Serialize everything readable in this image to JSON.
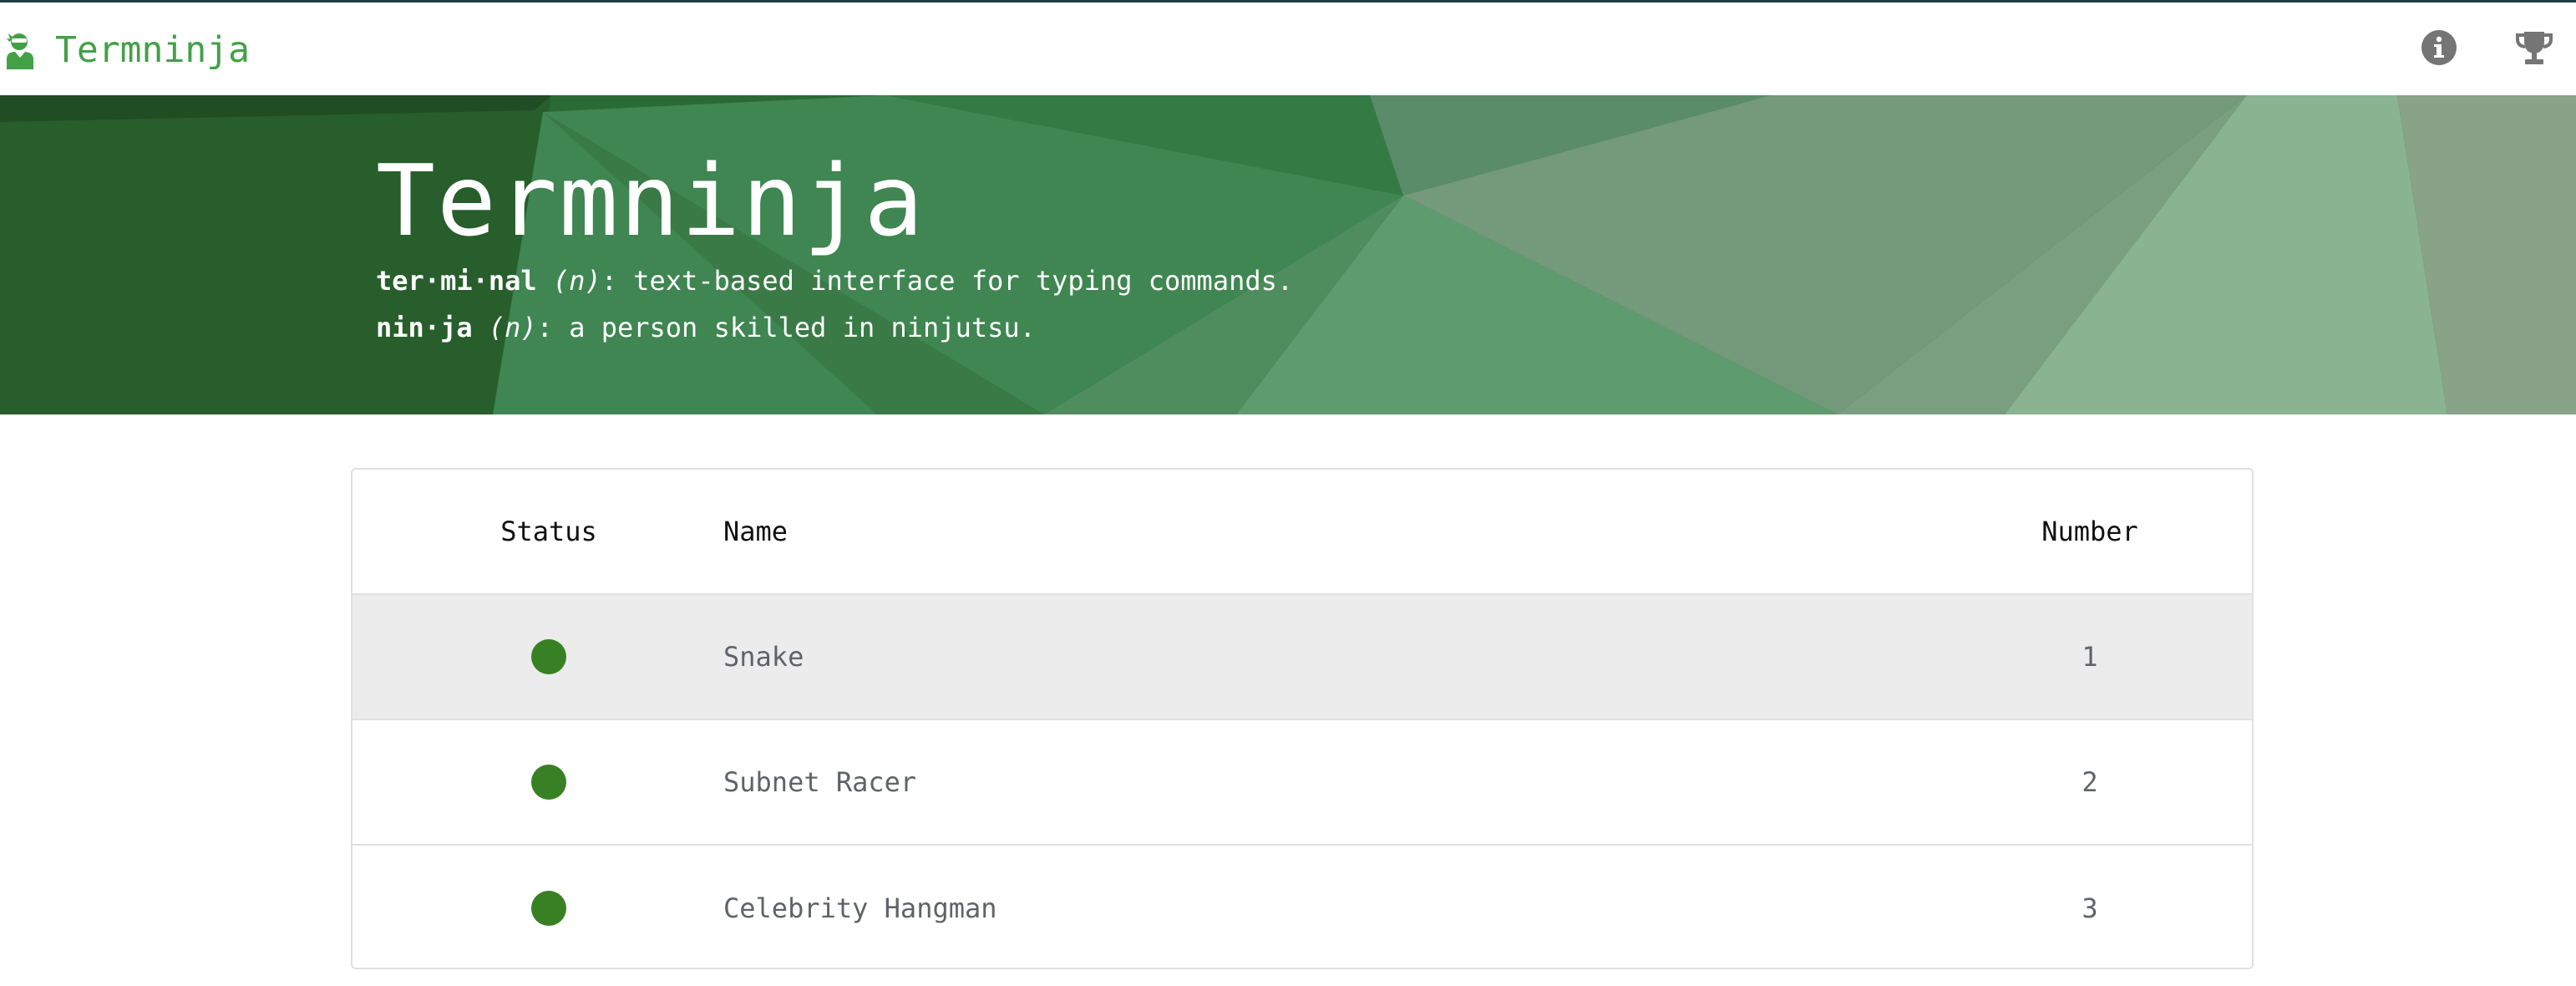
{
  "app": {
    "brand_text": "Termninja",
    "brand_color": "#43a047"
  },
  "navbar": {
    "icons": [
      "info-icon",
      "trophy-icon"
    ]
  },
  "hero": {
    "title": "Termninja",
    "definitions": [
      {
        "term": "ter·mi·nal",
        "pos": "(n)",
        "text": ": text-based interface for typing commands."
      },
      {
        "term": "nin·ja",
        "pos": "(n)",
        "text": ": a person skilled in ninjutsu."
      }
    ]
  },
  "table": {
    "headers": {
      "status": "Status",
      "name": "Name",
      "number": "Number"
    },
    "rows": [
      {
        "status": "online",
        "name": "Snake",
        "number": "1"
      },
      {
        "status": "online",
        "name": "Subnet Racer",
        "number": "2"
      },
      {
        "status": "online",
        "name": "Celebrity Hangman",
        "number": "3"
      }
    ],
    "status_color": "#388024",
    "highlight_row_color": "#ececec"
  }
}
